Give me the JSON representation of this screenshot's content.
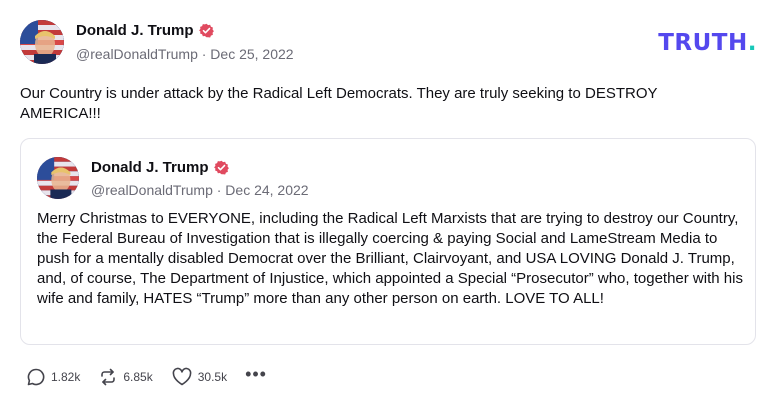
{
  "brand": {
    "logo_text": "TRUTH",
    "logo_dot": ".",
    "logo_color": "#5448ee",
    "dot_color": "#17c8b8"
  },
  "post": {
    "author": {
      "display_name": "Donald J. Trump",
      "meta": "@realDonaldTrump · Dec 25, 2022",
      "verified_icon": "verified-badge-icon",
      "verified_color": "#e04a5f"
    },
    "text": "Our Country is under attack by the Radical Left Democrats. They are truly seeking to DESTROY AMERICA!!!",
    "quote": {
      "author": {
        "display_name": "Donald J. Trump",
        "meta": "@realDonaldTrump · Dec 24, 2022",
        "verified_icon": "verified-badge-icon"
      },
      "text": "Merry Christmas to EVERYONE, including the Radical Left Marxists that are trying to destroy our Country, the Federal Bureau of Investigation that is illegally coercing & paying Social and LameStream Media to push for a mentally disabled Democrat over the Brilliant, Clairvoyant, and USA LOVING Donald J. Trump,  and, of course, The Department of Injustice, which appointed a Special “Prosecutor” who, together with his wife and family, HATES “Trump” more than any other person on earth. LOVE TO ALL!"
    },
    "actions": {
      "replies": {
        "icon": "reply-bubble-icon",
        "count": "1.82k"
      },
      "retruths": {
        "icon": "retruth-icon",
        "count": "6.85k"
      },
      "likes": {
        "icon": "heart-icon",
        "count": "30.5k"
      },
      "more": {
        "icon": "more-options-icon",
        "label": "•••"
      }
    }
  }
}
